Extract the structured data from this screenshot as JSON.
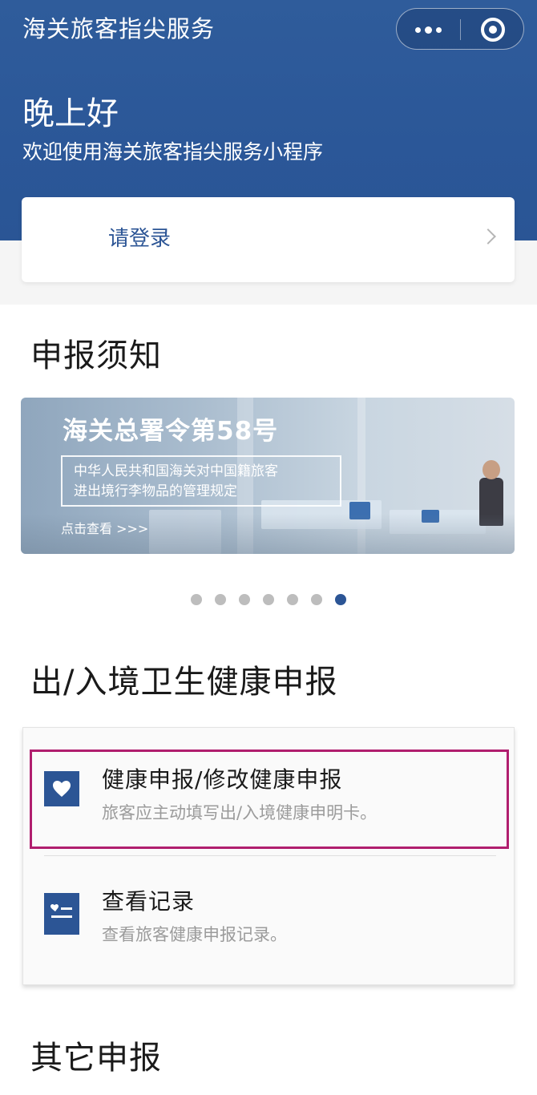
{
  "header": {
    "app_title": "海关旅客指尖服务",
    "greeting": "晚上好",
    "welcome": "欢迎使用海关旅客指尖服务小程序",
    "menu_icon": "more-dots-icon",
    "close_icon": "close-target-icon",
    "bg_color": "#2b5798"
  },
  "login": {
    "label": "请登录",
    "icon": "chevron-right-icon"
  },
  "notice": {
    "title": "申报须知",
    "banner": {
      "title": "海关总署令第58号",
      "line1": "中华人民共和国海关对中国籍旅客",
      "line2": "进出境行李物品的管理规定",
      "link": "点击查看 >>>"
    },
    "carousel": {
      "total": 7,
      "active_index": 6
    }
  },
  "health": {
    "title": "出/入境卫生健康申报",
    "items": [
      {
        "title": "健康申报/修改健康申报",
        "desc": "旅客应主动填写出/入境健康申明卡。",
        "icon": "heart-icon"
      },
      {
        "title": "查看记录",
        "desc": "查看旅客健康申报记录。",
        "icon": "record-list-icon"
      }
    ],
    "accent_color": "#2c5595",
    "highlight_color": "#b01e6e"
  },
  "other": {
    "title": "其它申报"
  }
}
